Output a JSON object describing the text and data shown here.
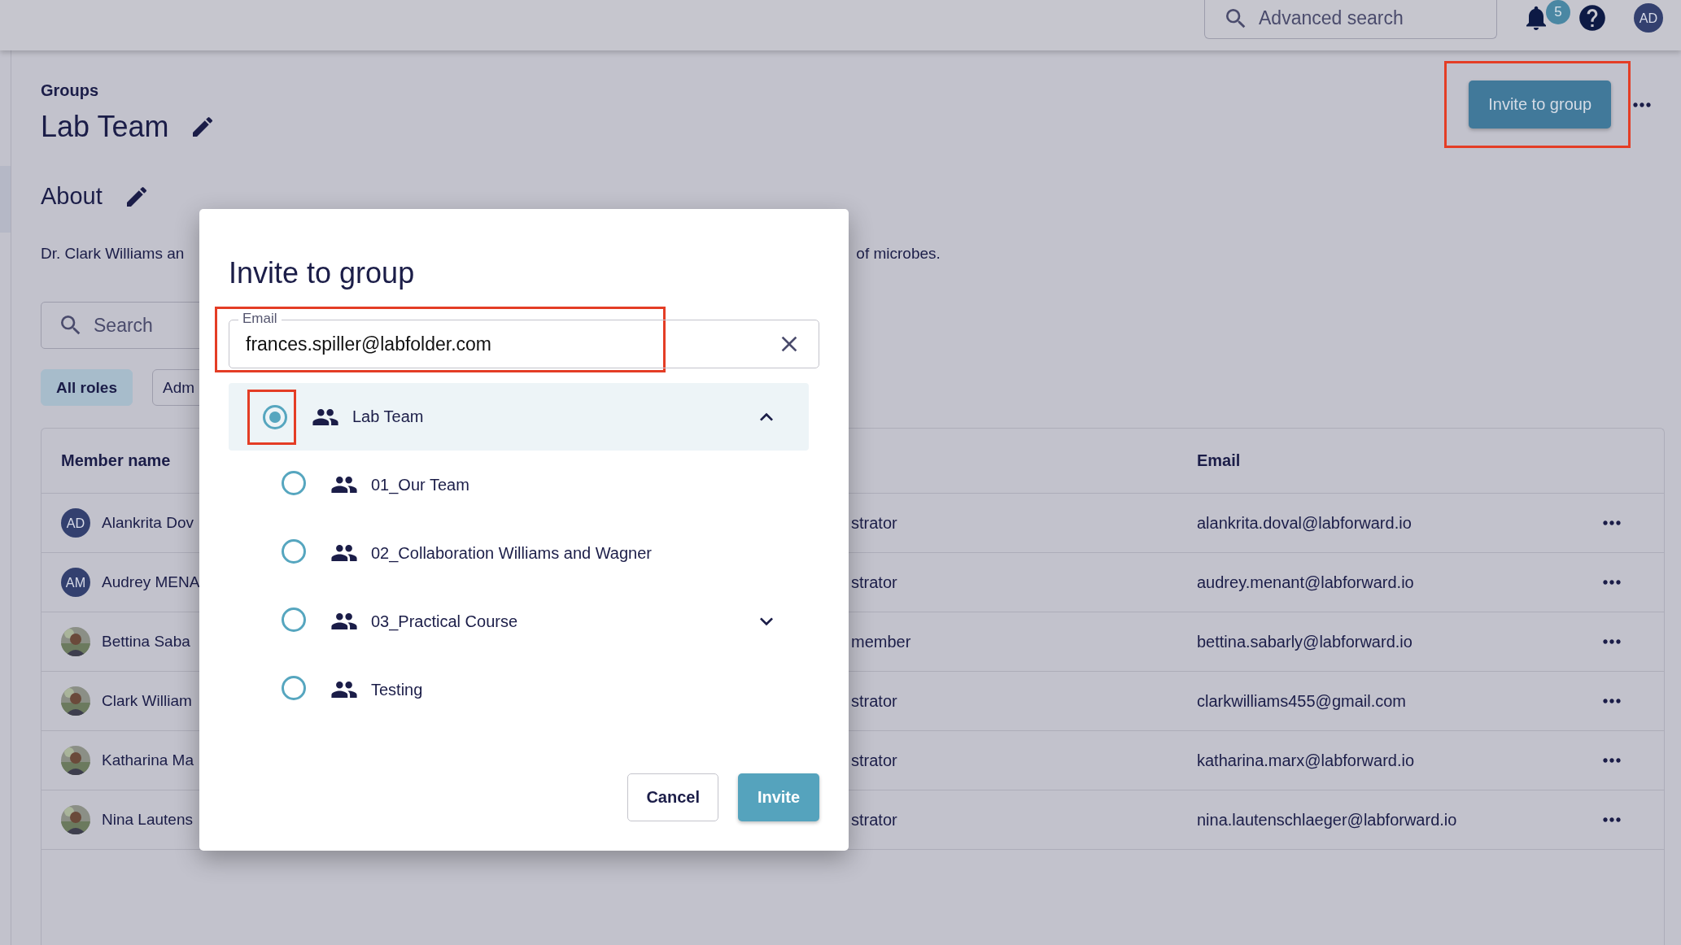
{
  "top_bar": {
    "search": {
      "placeholder": "Advanced search"
    },
    "notifications_badge": "5",
    "avatar": "AD"
  },
  "page": {
    "breadcrumb": "Groups",
    "title": "Lab Team",
    "about_heading": "About",
    "description_start": "Dr. Clark Williams an",
    "description_end": "of microbes.",
    "invite_button": "Invite to group",
    "search": {
      "placeholder": "Search"
    },
    "role_filters": [
      {
        "label": "All roles",
        "selected": true
      },
      {
        "label": "Adm",
        "selected": false
      }
    ],
    "table": {
      "columns": [
        "Member name",
        "Email"
      ],
      "rows": [
        {
          "name": "Alankrita Dov",
          "avatar": {
            "kind": "initials",
            "text": "AD"
          },
          "role": "strator",
          "email": "alankrita.doval@labforward.io"
        },
        {
          "name": "Audrey MENA",
          "avatar": {
            "kind": "initials",
            "text": "AM"
          },
          "role": "strator",
          "email": "audrey.menant@labforward.io"
        },
        {
          "name": "Bettina Saba",
          "role": "member",
          "email": "bettina.sabarly@labforward.io"
        },
        {
          "name": "Clark William",
          "role": "strator",
          "email": "clarkwilliams455@gmail.com"
        },
        {
          "name": "Katharina Ma",
          "role": "strator",
          "email": "katharina.marx@labforward.io"
        },
        {
          "name": "Nina Lautens",
          "role": "strator",
          "email": "nina.lautenschlaeger@labforward.io"
        }
      ]
    }
  },
  "dialog": {
    "title": "Invite to group",
    "email": {
      "label": "Email",
      "value": "frances.spiller@labfolder.com"
    },
    "groups": [
      {
        "name": "Lab Team",
        "selected": true,
        "expanded": true,
        "children": [
          {
            "name": "01_Our Team",
            "selected": false
          },
          {
            "name": "02_Collaboration Williams and Wagner",
            "selected": false
          },
          {
            "name": "03_Practical Course",
            "selected": false,
            "expanded": false
          },
          {
            "name": "Testing",
            "selected": false
          }
        ]
      }
    ],
    "buttons": [
      {
        "label": "Cancel",
        "kind": "secondary"
      },
      {
        "label": "Invite",
        "kind": "primary"
      }
    ]
  }
}
